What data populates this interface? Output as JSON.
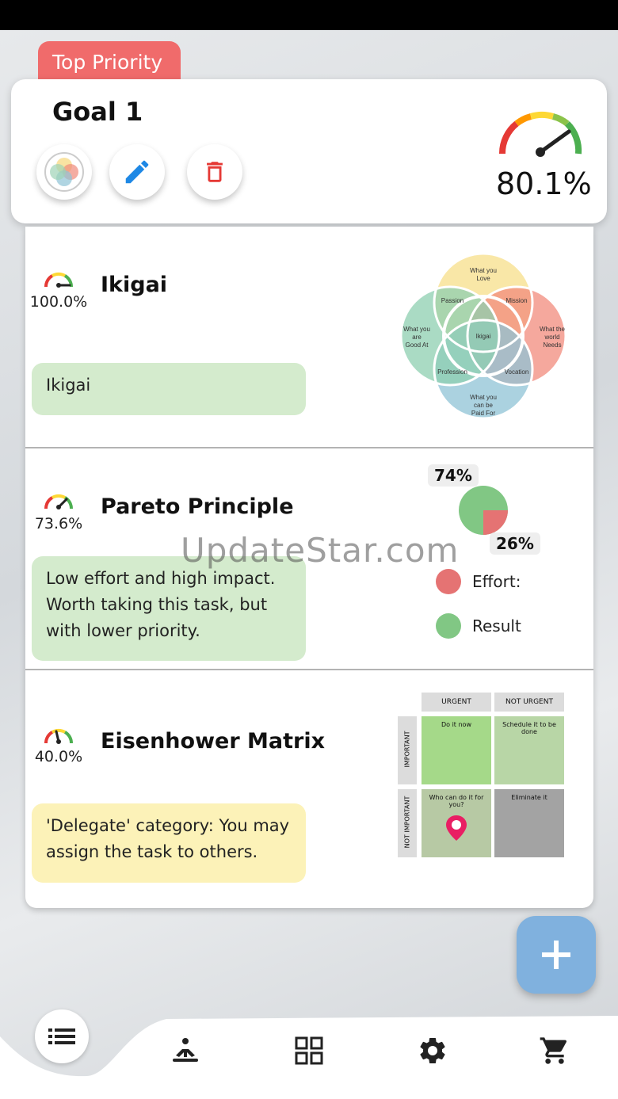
{
  "goal": {
    "tag": "Top Priority",
    "title": "Goal 1",
    "progress_text": "80.1%",
    "progress": 0.801,
    "actions": {
      "view_icon": "ikigai-icon",
      "edit_icon": "pencil-icon",
      "delete_icon": "trash-icon"
    }
  },
  "tasks": [
    {
      "title": "Ikigai",
      "progress_text": "100.0%",
      "progress": 1.0,
      "note": "Ikigai",
      "note_color": "#d4ebcd",
      "diagram": {
        "type": "venn",
        "outer": [
          "What you Love",
          "What the world Needs",
          "What you can be Paid For",
          "What you are Good At"
        ],
        "overlaps": [
          "Passion",
          "Mission",
          "Vocation",
          "Profession"
        ],
        "center": "Ikigai"
      }
    },
    {
      "title": "Pareto Principle",
      "progress_text": "73.6%",
      "progress": 0.736,
      "note": "Low effort and high impact. Worth taking this task, but with lower priority.",
      "note_color": "#d4ebcd",
      "chart": {
        "big_pct": "74%",
        "small_pct": "26%",
        "legend": [
          "Effort:",
          "Result"
        ],
        "colors": [
          "#e57373",
          "#81c784"
        ]
      }
    },
    {
      "title": "Eisenhower Matrix",
      "progress_text": "40.0%",
      "progress": 0.4,
      "note": "'Delegate' category: You may assign the task to others.",
      "note_color": "#fcf2b8",
      "matrix": {
        "col_headers": [
          "URGENT",
          "NOT URGENT"
        ],
        "row_headers": [
          "IMPORTANT",
          "NOT IMPORTANT"
        ],
        "cells": [
          "Do it now",
          "Schedule it to be done",
          "Who can do it for you?",
          "Eliminate it"
        ]
      }
    }
  ],
  "watermark": "UpdateStar.com",
  "nav": [
    "list-icon",
    "meditation-icon",
    "dashboard-icon",
    "settings-icon",
    "cart-icon"
  ]
}
